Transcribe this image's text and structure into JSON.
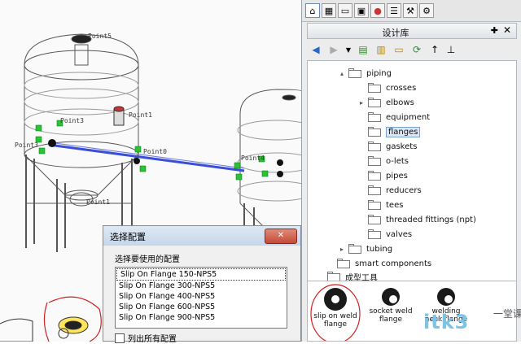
{
  "viewport": {
    "point_labels": [
      "Point5",
      "Point3",
      "Point1",
      "Point1",
      "Point3",
      "Point4",
      "Point0"
    ]
  },
  "panel": {
    "title": "设计库",
    "pin_glyph": "✚",
    "close_glyph": "✕",
    "tabs": [
      "home-icon",
      "parts-icon",
      "folder-icon",
      "palette-icon",
      "appearance-icon",
      "properties-icon",
      "tools-icon",
      "custom-icon"
    ],
    "toolbar": [
      "back-icon",
      "forward-icon",
      "dropdown-icon",
      "add-library-icon",
      "add-folder-icon",
      "new-folder-icon",
      "refresh-icon",
      "up-icon",
      "pin-icon"
    ],
    "tree": [
      {
        "label": "piping",
        "expand": "▴",
        "indent": 1
      },
      {
        "label": "crosses",
        "expand": "",
        "indent": 2
      },
      {
        "label": "elbows",
        "expand": "▸",
        "indent": 2
      },
      {
        "label": "equipment",
        "expand": "",
        "indent": 2
      },
      {
        "label": "flanges",
        "expand": "",
        "indent": 2,
        "selected": true
      },
      {
        "label": "gaskets",
        "expand": "",
        "indent": 2
      },
      {
        "label": "o-lets",
        "expand": "",
        "indent": 2
      },
      {
        "label": "pipes",
        "expand": "",
        "indent": 2
      },
      {
        "label": "reducers",
        "expand": "",
        "indent": 2
      },
      {
        "label": "tees",
        "expand": "",
        "indent": 2
      },
      {
        "label": "threaded fittings (npt)",
        "expand": "",
        "indent": 2
      },
      {
        "label": "valves",
        "expand": "",
        "indent": 2
      },
      {
        "label": "tubing",
        "expand": "▸",
        "indent": 1
      },
      {
        "label": "smart components",
        "expand": "",
        "indent": 0
      },
      {
        "label": "成型工具",
        "expand": "",
        "indent": -1
      }
    ],
    "preview": [
      {
        "line1": "slip on weld",
        "line2": "flange"
      },
      {
        "line1": "socket weld",
        "line2": "flange"
      },
      {
        "line1": "welding",
        "line2": "neck flange"
      }
    ]
  },
  "dialog": {
    "title": "选择配置",
    "close_label": "✕",
    "prompt": "选择要使用的配置",
    "options": [
      "Slip On Flange 150-NPS5",
      "Slip On Flange 300-NPS5",
      "Slip On Flange 400-NPS5",
      "Slip On Flange 600-NPS5",
      "Slip On Flange 900-NPS5"
    ],
    "selected_index": 0,
    "show_all_label": "列出所有配置",
    "show_all_checked": false
  },
  "watermark": {
    "site": "itk3",
    "tagline": "一堂课"
  },
  "colors": {
    "pipe": "#3b4fd6",
    "marker": "#2fbf3a",
    "tank_line": "#555555",
    "annotation": "#d02020"
  }
}
